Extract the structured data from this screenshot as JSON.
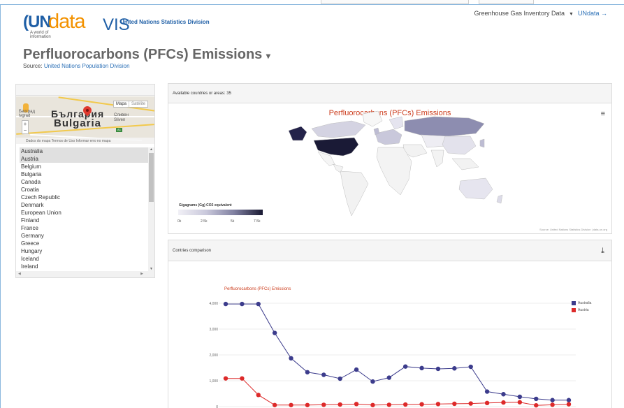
{
  "app": {
    "logo_un": "UN",
    "logo_data": "data",
    "logo_vis": "VIS",
    "logo_tagline": "A world of information",
    "division": "United Nations Statistics Division"
  },
  "topnav": {
    "dataset": "Greenhouse Gas Inventory Data",
    "link": "UNdata →"
  },
  "page": {
    "title": "Perfluorocarbons (PFCs) Emissions",
    "source_label": "Source:",
    "source_link": "United Nations Population Division"
  },
  "minimap": {
    "map_button": "Mapa",
    "satellite_button": "Satélite",
    "label_cyrillic": "България",
    "label_latin": "Bulgaria",
    "city_cyrillic": "Сливен",
    "city_latin": "Sliven",
    "city_left": "Београд",
    "city_left2": "lvgrad",
    "road_shield": "A1",
    "footer": "Dados do mapa   Termos de Uso   Informar erro no mapa"
  },
  "countries": [
    "Australia",
    "Austria",
    "Belgium",
    "Bulgaria",
    "Canada",
    "Croatia",
    "Czech Republic",
    "Denmark",
    "European Union",
    "Finland",
    "France",
    "Germany",
    "Greece",
    "Hungary",
    "Iceland",
    "Ireland"
  ],
  "selected_countries": [
    "Australia",
    "Austria"
  ],
  "map_panel": {
    "header": "Available countries or areas: 35",
    "title": "Perfluorocarbons (PFCs) Emissions",
    "legend_title": "Gigagrams (Gg) CO2 equivalent",
    "legend_ticks": [
      "0k",
      "2.5k",
      "5k",
      "7.5k"
    ],
    "source": "Source: United Nations Statistics Division | data.un.org"
  },
  "comparison_panel": {
    "header": "Contries comparison",
    "title": "Perfluorocarbons (PFCs) Emissions"
  },
  "icons": {
    "menu": "hamburger-menu-icon",
    "download": "download-icon"
  },
  "colors": {
    "australia": "#3c3c8c",
    "austria": "#dd2a2a",
    "title_red": "#cc3c1c",
    "link_blue": "#2a6fb6"
  },
  "chart_data": {
    "type": "line",
    "title": "Perfluorocarbons (PFCs) Emissions",
    "y_ticks": [
      "4,000",
      "3,000",
      "2,000",
      "1,000",
      "0"
    ],
    "ylim": [
      0,
      4000
    ],
    "series": [
      {
        "name": "Australia",
        "color": "#3c3c8c",
        "values": [
          3970,
          3970,
          3970,
          2850,
          1870,
          1330,
          1230,
          1080,
          1430,
          970,
          1120,
          1550,
          1490,
          1460,
          1480,
          1540,
          580,
          480,
          380,
          300,
          250,
          250
        ]
      },
      {
        "name": "Austria",
        "color": "#dd2a2a",
        "values": [
          1090,
          1090,
          450,
          60,
          60,
          60,
          70,
          80,
          100,
          60,
          70,
          80,
          90,
          100,
          110,
          120,
          140,
          160,
          170,
          50,
          70,
          90
        ]
      }
    ]
  }
}
